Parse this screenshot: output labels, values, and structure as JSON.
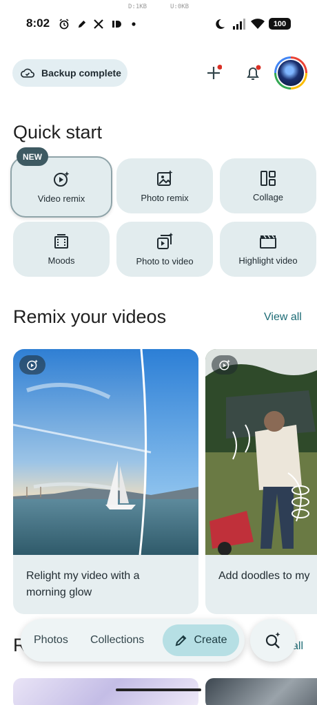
{
  "debug": {
    "download": "D:1KB",
    "upload": "U:0KB"
  },
  "status_bar": {
    "time": "8:02",
    "battery": "100",
    "icons": [
      "alarm-icon",
      "pen-icon",
      "x-logo-icon",
      "app-icon",
      "dot-icon",
      "moon-icon",
      "signal-icon",
      "wifi-icon"
    ]
  },
  "header": {
    "backup_label": "Backup complete",
    "icons": [
      "cloud-check-icon",
      "add-icon",
      "notifications-icon"
    ],
    "notification_dot_color": "#d93025"
  },
  "quick_start": {
    "title": "Quick start",
    "new_badge": "NEW",
    "tiles": [
      {
        "label": "Video remix",
        "icon": "video-remix-icon"
      },
      {
        "label": "Photo remix",
        "icon": "photo-remix-icon"
      },
      {
        "label": "Collage",
        "icon": "collage-icon"
      },
      {
        "label": "Moods",
        "icon": "moods-icon"
      },
      {
        "label": "Photo to video",
        "icon": "photo-to-video-icon"
      },
      {
        "label": "Highlight video",
        "icon": "highlight-video-icon"
      }
    ]
  },
  "remix": {
    "title": "Remix your videos",
    "view_all": "View all",
    "cards": [
      {
        "line1": "Relight my video with a",
        "line2": "morning glow"
      },
      {
        "line1": "Add doodles to my",
        "line2": ""
      }
    ]
  },
  "next_section": {
    "title_partial": "R",
    "view_all_partial": "all"
  },
  "bottom_nav": {
    "items": [
      "Photos",
      "Collections"
    ],
    "create": "Create",
    "search_icon": "search-sparkle-icon"
  },
  "colors": {
    "accent": "#1c6b75",
    "tile_bg": "#e2ecee",
    "create_bg": "#b6dfe4"
  }
}
